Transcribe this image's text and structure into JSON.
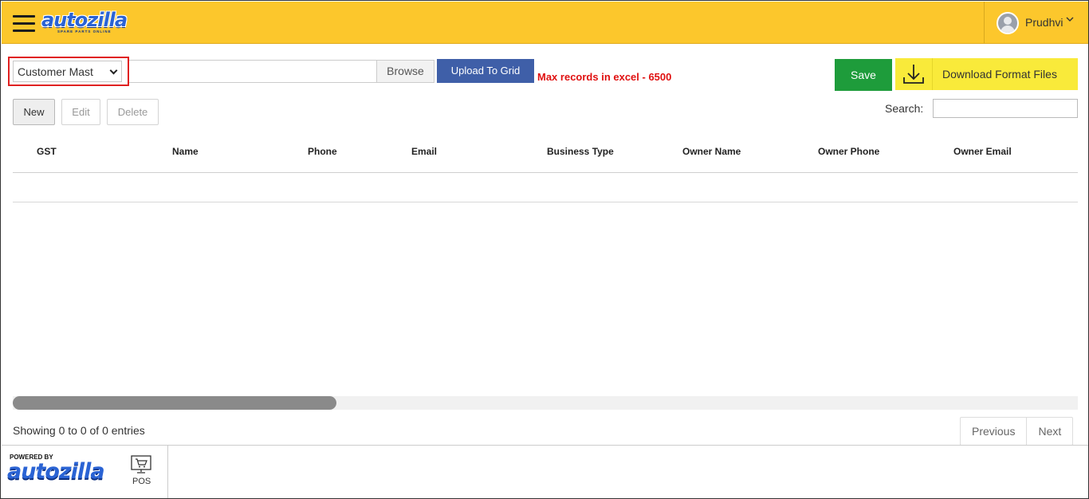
{
  "header": {
    "brand": "autozilla",
    "brand_tagline": "SPARE PARTS ONLINE",
    "user_name": "Prudhvi",
    "accent_color": "#fcc72c"
  },
  "upload": {
    "master_select_value": "Customer Mast",
    "file_input_value": "",
    "browse_label": "Browse",
    "upload_label": "Upload To Grid",
    "max_records_note": "Max records in excel - 6500",
    "save_label": "Save",
    "download_label": "Download Format Files"
  },
  "actions": {
    "new_label": "New",
    "edit_label": "Edit",
    "delete_label": "Delete",
    "search_label": "Search:",
    "search_value": ""
  },
  "table": {
    "columns": [
      "GST",
      "Name",
      "Phone",
      "Email",
      "Business Type",
      "Owner Name",
      "Owner Phone",
      "Owner Email"
    ],
    "rows": []
  },
  "pagination": {
    "info": "Showing 0 to 0 of 0 entries",
    "previous_label": "Previous",
    "next_label": "Next"
  },
  "footer": {
    "powered_by": "POWERED BY",
    "brand": "autozilla",
    "pos_label": "POS"
  },
  "icons": {
    "menu": "hamburger-icon",
    "user": "user-avatar",
    "dropdown": "chevron-down-icon",
    "download": "download-icon",
    "pos": "pos-terminal-icon"
  }
}
